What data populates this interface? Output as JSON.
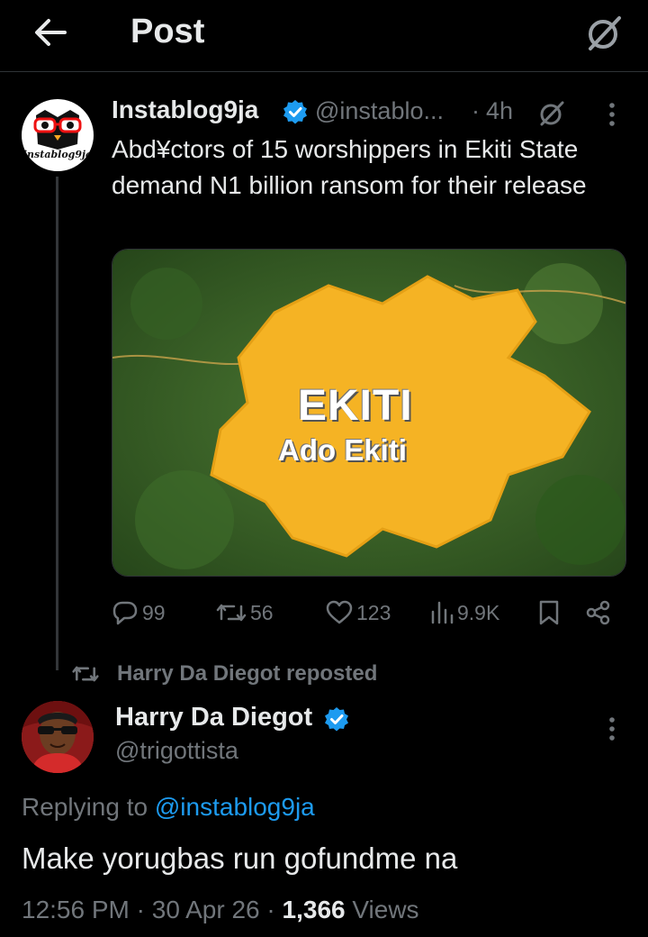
{
  "header": {
    "title": "Post"
  },
  "parent_post": {
    "display_name": "Instablog9ja",
    "handle": "@instablo...",
    "separator": "·",
    "time": "4h",
    "avatar_text": "instablog9ja",
    "text": "Abd¥ctors of 15 worshippers in Ekiti State demand N1 billion ransom for their release",
    "image": {
      "title": "EKITI",
      "subtitle": "Ado Ekiti"
    },
    "stats": {
      "replies": "99",
      "reposts": "56",
      "likes": "123",
      "views": "9.9K"
    }
  },
  "repost_banner": {
    "text": "Harry Da Diegot reposted"
  },
  "reply": {
    "display_name": "Harry Da Diegot",
    "handle": "@trigottista",
    "replying_prefix": "Replying to ",
    "replying_to": "@instablog9ja",
    "text": "Make yorugbas run gofundme na",
    "time": "12:56 PM",
    "date": "30 Apr 26",
    "views_count": "1,366",
    "views_label": "Views",
    "dot": " · "
  },
  "colors": {
    "background": "#000000",
    "text_primary": "#e7e9ea",
    "text_secondary": "#71767b",
    "accent_link": "#1d9bf0",
    "verified_badge": "#1d9bf0",
    "map_state": "#f5b324",
    "map_background": "#3f6e2a"
  }
}
